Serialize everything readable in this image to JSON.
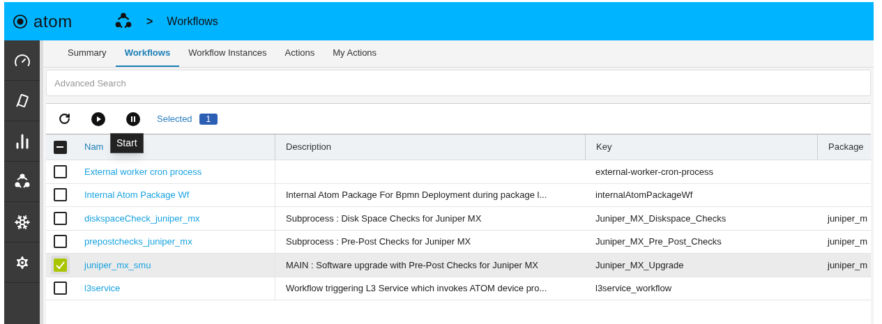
{
  "header": {
    "logo": "atom",
    "breadcrumb": [
      {
        "text": ">",
        "kind": "separator"
      },
      {
        "text": "Workflows",
        "kind": "page"
      }
    ]
  },
  "sidebar": {
    "items": [
      {
        "kind": "gauge"
      },
      {
        "kind": "cards"
      },
      {
        "kind": "chart"
      },
      {
        "kind": "nodes"
      },
      {
        "kind": "snowflake"
      },
      {
        "kind": "gear"
      }
    ]
  },
  "tabs": [
    {
      "label": "Summary",
      "selected": false
    },
    {
      "label": "Workflows",
      "selected": true
    },
    {
      "label": "Workflow Instances",
      "selected": false
    },
    {
      "label": "Actions",
      "selected": false
    },
    {
      "label": "My Actions",
      "selected": false
    }
  ],
  "search": {
    "placeholder": "Advanced Search"
  },
  "toolbar": {
    "selected_label": "Selected",
    "selected_count": "1",
    "tooltip": "Start"
  },
  "table": {
    "select_all": {
      "indeterminate": true
    },
    "columns": [
      "Nam",
      "Description",
      "Key",
      "Package"
    ],
    "rows": [
      {
        "selected": false,
        "cells": [
          "External worker cron process",
          "",
          "external-worker-cron-process",
          ""
        ]
      },
      {
        "selected": false,
        "cells": [
          "Internal Atom Package Wf",
          "Internal Atom Package For Bpmn Deployment during package l...",
          "internalAtomPackageWf",
          ""
        ]
      },
      {
        "selected": false,
        "cells": [
          "diskspaceCheck_juniper_mx",
          "Subprocess : Disk Space Checks for Juniper MX",
          "Juniper_MX_Diskspace_Checks",
          "juniper_m"
        ]
      },
      {
        "selected": false,
        "cells": [
          "prepostchecks_juniper_mx",
          "Subprocess : Pre-Post Checks for Juniper MX",
          "Juniper_MX_Pre_Post_Checks",
          "juniper_m"
        ]
      },
      {
        "selected": true,
        "cells": [
          "juniper_mx_smu",
          "MAIN : Software upgrade with Pre-Post Checks for Juniper MX",
          "Juniper_MX_Upgrade",
          "juniper_m"
        ]
      },
      {
        "selected": false,
        "cells": [
          "l3service",
          "Workflow triggering L3 Service which invokes ATOM device pro...",
          "l3service_workflow",
          ""
        ]
      }
    ]
  }
}
